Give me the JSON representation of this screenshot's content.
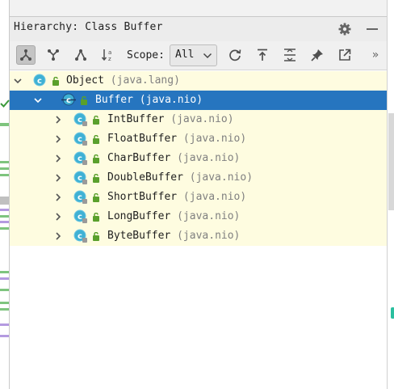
{
  "window": {
    "title": "Hierarchy: Class Buffer"
  },
  "toolbar": {
    "buttons": [
      {
        "name": "subtypes-hierarchy-icon",
        "active": true
      },
      {
        "name": "supertypes-hierarchy-icon",
        "active": false
      },
      {
        "name": "class-hierarchy-icon",
        "active": false
      },
      {
        "name": "sort-alphabetically-icon",
        "active": false
      }
    ],
    "scope_label": "Scope:",
    "scope_value": "All",
    "right_buttons": [
      "refresh-icon",
      "export-icon",
      "expand-all-icon",
      "pin-icon",
      "open-in-new-icon"
    ],
    "overflow": "»"
  },
  "colors": {
    "selection": "#2675bf",
    "tree_background": "#fefce0",
    "class_icon": "#3fb1d4",
    "access_icon": "#5aa02c"
  },
  "tree": {
    "root": {
      "name": "Object",
      "package": "(java.lang)"
    },
    "selected": {
      "name": "Buffer",
      "package": "(java.nio)"
    },
    "children": [
      {
        "name": "IntBuffer",
        "package": "(java.nio)"
      },
      {
        "name": "FloatBuffer",
        "package": "(java.nio)"
      },
      {
        "name": "CharBuffer",
        "package": "(java.nio)"
      },
      {
        "name": "DoubleBuffer",
        "package": "(java.nio)"
      },
      {
        "name": "ShortBuffer",
        "package": "(java.nio)"
      },
      {
        "name": "LongBuffer",
        "package": "(java.nio)"
      },
      {
        "name": "ByteBuffer",
        "package": "(java.nio)"
      }
    ]
  }
}
